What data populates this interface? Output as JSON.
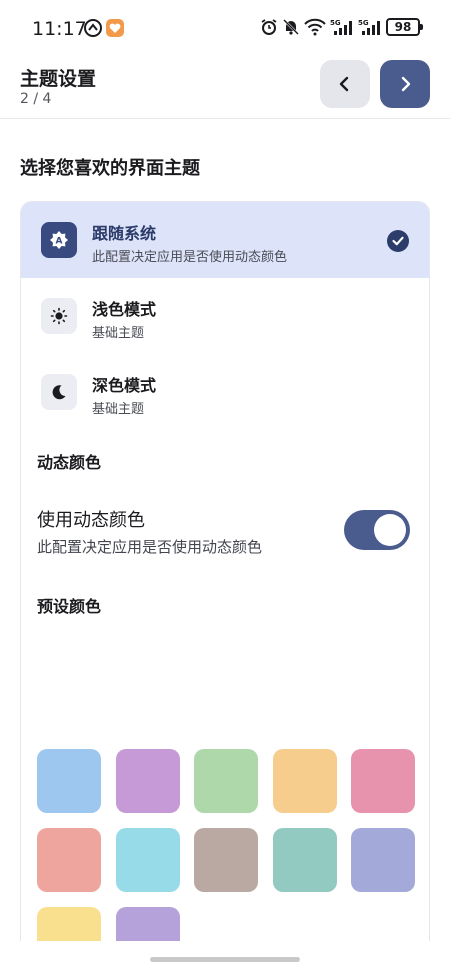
{
  "status_bar": {
    "time": "11:17",
    "battery": "98",
    "icons": [
      "dashboard-app-icon",
      "heart-app-icon",
      "alarm-icon",
      "mute-icon",
      "wifi-icon",
      "signal-5g-icon",
      "signal-5g-icon"
    ]
  },
  "header": {
    "title": "主题设置",
    "step": "2 / 4",
    "prev_icon": "chevron-left-icon",
    "next_icon": "chevron-right-icon"
  },
  "section_title": "选择您喜欢的界面主题",
  "themes": [
    {
      "name": "跟随系统",
      "desc": "此配置决定应用是否使用动态颜色",
      "icon": "auto-brightness-icon",
      "selected": true
    },
    {
      "name": "浅色模式",
      "desc": "基础主题",
      "icon": "sun-icon",
      "selected": false
    },
    {
      "name": "深色模式",
      "desc": "基础主题",
      "icon": "moon-icon",
      "selected": false
    }
  ],
  "dynamic_color": {
    "heading": "动态颜色",
    "title": "使用动态颜色",
    "desc": "此配置决定应用是否使用动态颜色",
    "enabled": true
  },
  "preset_colors": {
    "heading": "预设颜色",
    "swatches": [
      "#9ec7f0",
      "#c69ad6",
      "#afd8aa",
      "#f6cd8d",
      "#e893ad",
      "#eea59d",
      "#98dbe8",
      "#baa9a3",
      "#92c9c1",
      "#a3a9d8",
      "#f9e08f",
      "#b6a2db"
    ]
  },
  "colors": {
    "accent": "#4a5b8d",
    "selected_bg": "#dde3f9"
  }
}
